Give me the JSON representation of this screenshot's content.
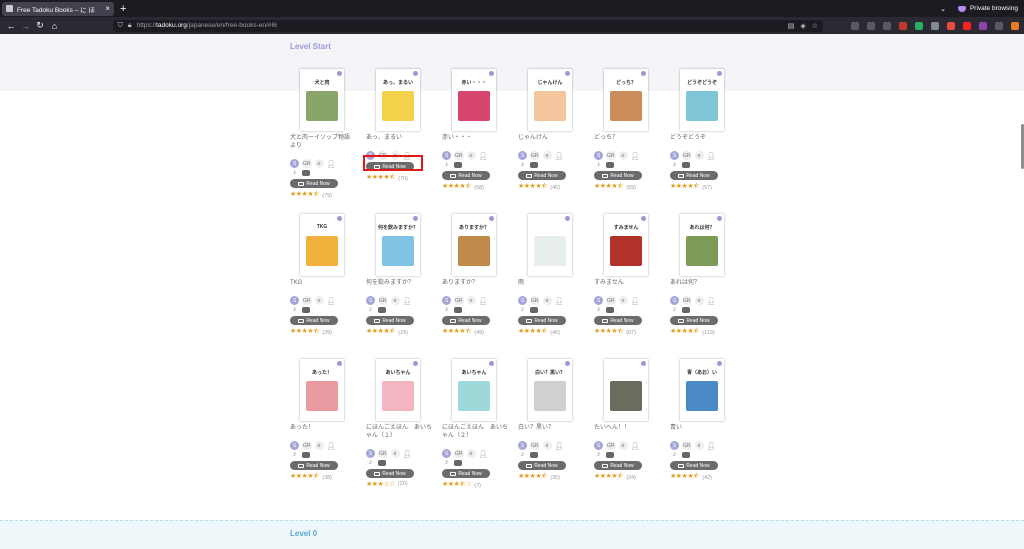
{
  "browser": {
    "tab_title": "Free Tadoku Books – に ほ",
    "private_label": "Private browsing",
    "url_prefix": "https://",
    "url_host": "tadoku.org",
    "url_path": "/japanese/en/free-books-en/#I6"
  },
  "sections": {
    "level_start": "Level Start",
    "level_0": "Level 0"
  },
  "labels": {
    "read_now": "Read Now",
    "tag_level": "S",
    "tag_gr": "GR",
    "tag_e": "e",
    "tag_jp": "jp",
    "tag_a": "あ"
  },
  "books": [
    {
      "title": "犬と肉ーイソップ物語より",
      "cover_text": "犬と肉",
      "count": "(79)",
      "rating": 4.5,
      "color": "#8aa56a"
    },
    {
      "title": "あっ、まるい",
      "cover_text": "あっ、まるい",
      "count": "(70)",
      "rating": 4.5,
      "color": "#f1d24a"
    },
    {
      "title": "赤い・・・",
      "cover_text": "赤い・・・",
      "count": "(58)",
      "rating": 4.5,
      "color": "#d84670"
    },
    {
      "title": "じゃんけん",
      "cover_text": "じゃんけん",
      "count": "(46)",
      "rating": 4.5,
      "color": "#f4c6a0"
    },
    {
      "title": "どっち？",
      "cover_text": "どっち？",
      "count": "(59)",
      "rating": 4.5,
      "color": "#c98c5a"
    },
    {
      "title": "どうぞどうぞ",
      "cover_text": "どうぞどうぞ",
      "count": "(57)",
      "rating": 4.5,
      "color": "#7fc6d8"
    },
    {
      "title": "TKG",
      "cover_text": "TKG",
      "count": "(29)",
      "rating": 4.5,
      "color": "#f0b23c"
    },
    {
      "title": "何を飲みますか？",
      "cover_text": "何を飲みますか？",
      "count": "(29)",
      "rating": 4.5,
      "color": "#7ec3e4"
    },
    {
      "title": "ありますか？",
      "cover_text": "ありますか？",
      "count": "(49)",
      "rating": 4.5,
      "color": "#c08a4a"
    },
    {
      "title": "雨",
      "cover_text": "",
      "count": "(46)",
      "rating": 4.5,
      "color": "#e8efea"
    },
    {
      "title": "すみません",
      "cover_text": "すみません",
      "count": "(67)",
      "rating": 4.5,
      "color": "#b3322c"
    },
    {
      "title": "あれは何？",
      "cover_text": "あれは何？",
      "count": "(119)",
      "rating": 4.5,
      "color": "#7d9a56"
    },
    {
      "title": "あった！",
      "cover_text": "あった！",
      "count": "(38)",
      "rating": 4.5,
      "color": "#e89aa0"
    },
    {
      "title": "にほんごえほん　あいちゃん（１）",
      "cover_text": "あいちゃん",
      "count": "(20)",
      "rating": 3,
      "color": "#f4b6c2"
    },
    {
      "title": "にほんごえほん　あいちゃん（２）",
      "cover_text": "あいちゃん",
      "count": "(7)",
      "rating": 3.5,
      "color": "#9fd8d8"
    },
    {
      "title": "白い？黒い？",
      "cover_text": "白い？黒い？",
      "count": "(35)",
      "rating": 4.5,
      "color": "#d0d0d0"
    },
    {
      "title": "たいへん！！",
      "cover_text": "",
      "count": "(24)",
      "rating": 4.5,
      "color": "#6b6b5e"
    },
    {
      "title": "青い",
      "cover_text": "青（あお）い",
      "count": "(42)",
      "rating": 4.5,
      "color": "#4a8ac4"
    }
  ]
}
